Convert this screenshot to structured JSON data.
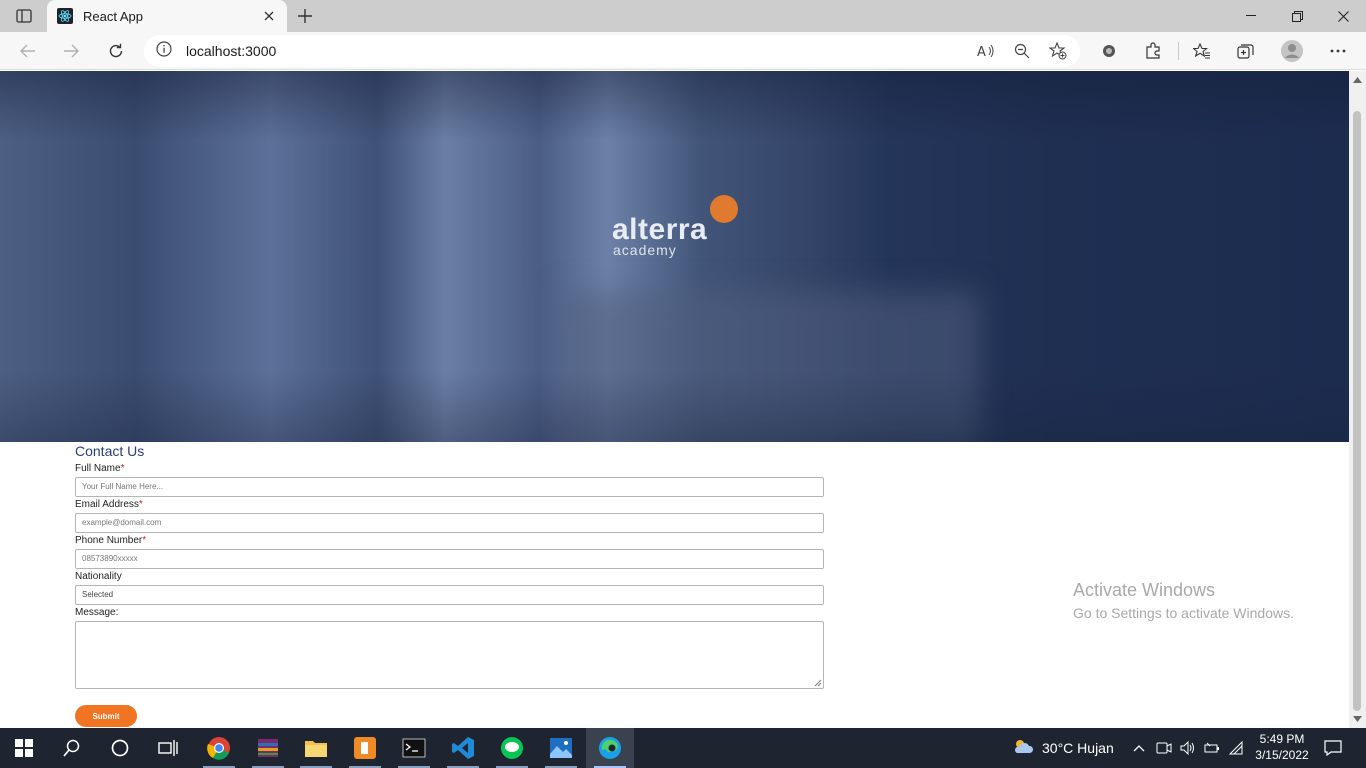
{
  "browser": {
    "tab_title": "React App",
    "url": "localhost:3000"
  },
  "hero": {
    "logo_word": "alterra",
    "logo_sub": "academy",
    "accent_color": "#e07a2e"
  },
  "form": {
    "heading": "Contact Us",
    "required_mark": "*",
    "fields": {
      "full_name": {
        "label": "Full Name",
        "placeholder": "Your Full Name Here..."
      },
      "email": {
        "label": "Email Address",
        "placeholder": "example@domail.com"
      },
      "phone": {
        "label": "Phone Number",
        "placeholder": "08573890xxxxx"
      },
      "nationality": {
        "label": "Nationality",
        "value": "Selected"
      },
      "message": {
        "label": "Message:"
      }
    },
    "submit_label": "Submit",
    "submit_color": "#f07422"
  },
  "watermark": {
    "line1": "Activate Windows",
    "line2": "Go to Settings to activate Windows."
  },
  "taskbar": {
    "weather": "30°C Hujan",
    "time": "5:49 PM",
    "date": "3/15/2022"
  }
}
